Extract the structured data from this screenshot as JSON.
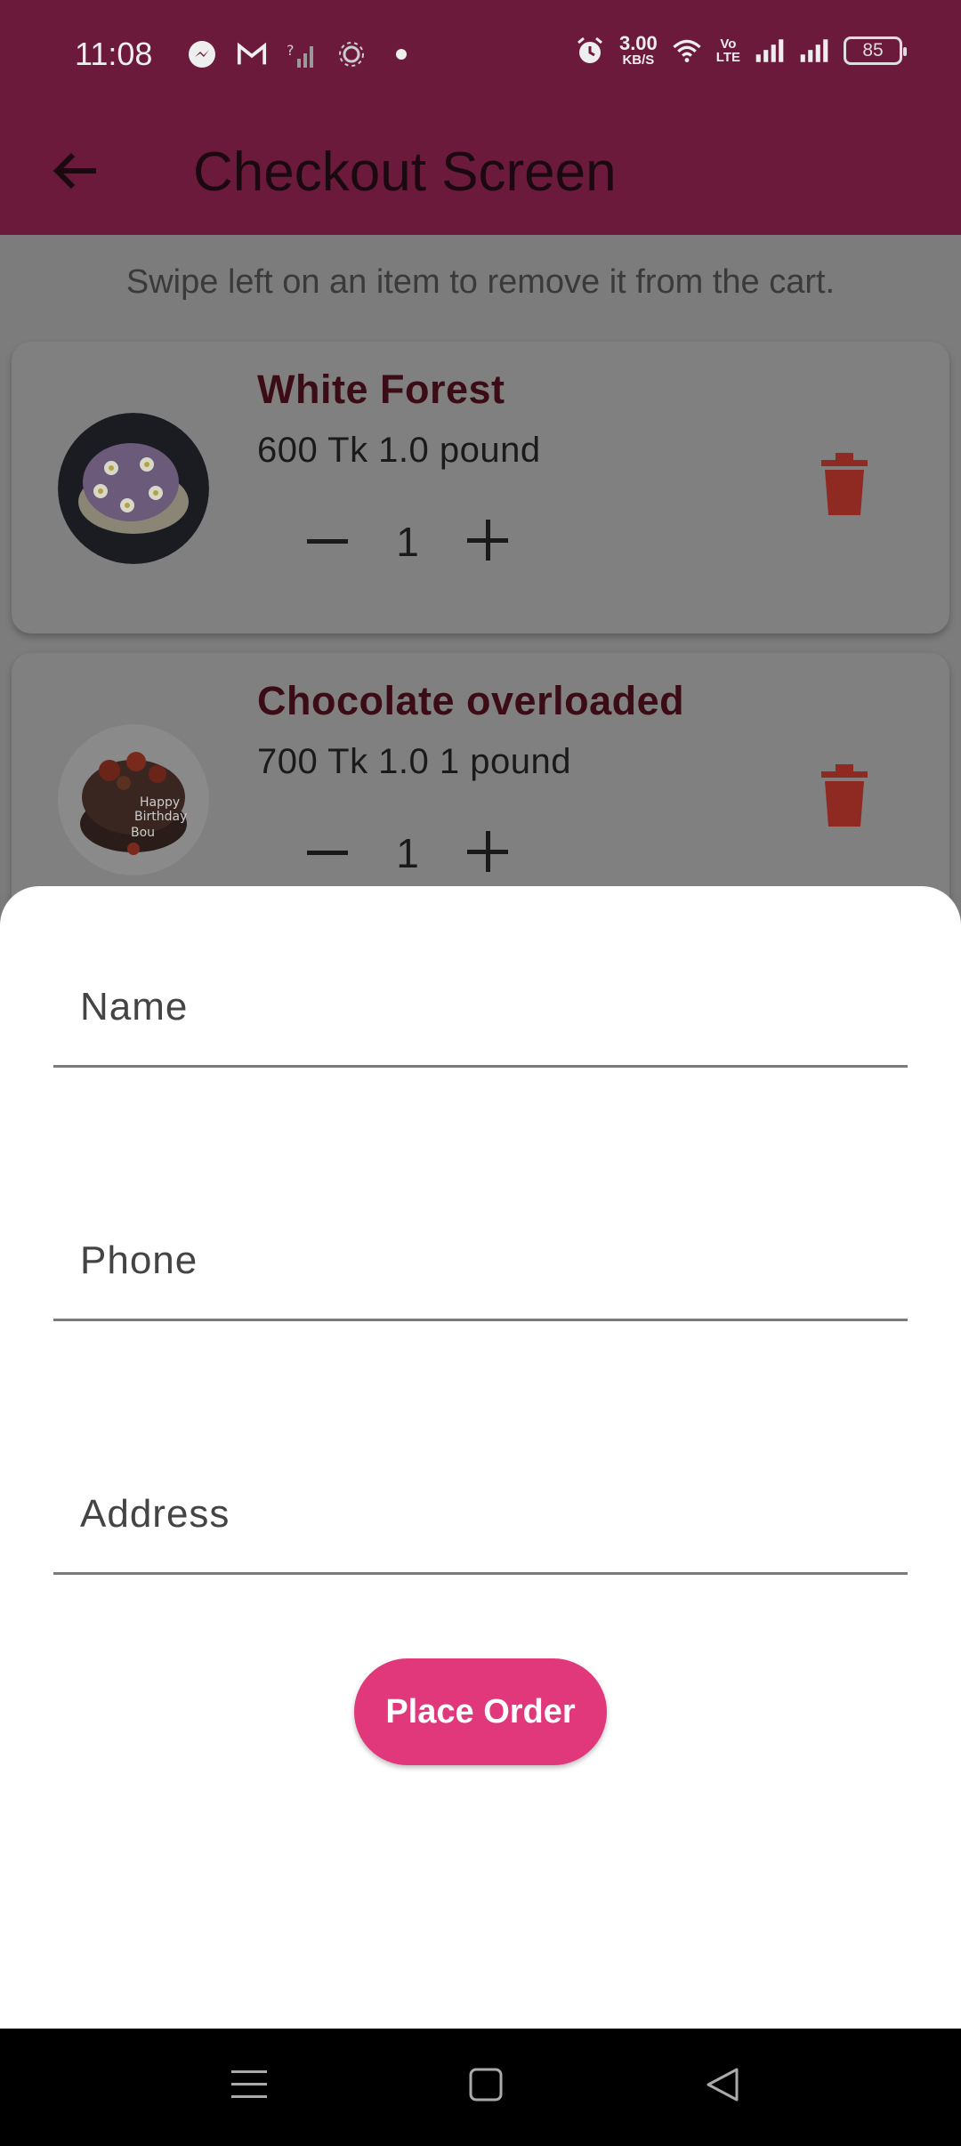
{
  "status_bar": {
    "time": "11:08",
    "net_speed_value": "3.00",
    "net_speed_unit": "KB/S",
    "volte_top": "Vo",
    "volte_bottom": "LTE",
    "battery": "85",
    "left_icons": [
      "messenger-icon",
      "gmail-icon",
      "no-signal-icon",
      "settings-cog-icon",
      "dot-icon"
    ],
    "right_icons": [
      "alarm-icon",
      "wifi-icon",
      "volte-icon",
      "signal-icon",
      "signal-icon",
      "battery-icon"
    ]
  },
  "app_bar": {
    "title": "Checkout Screen",
    "back_icon": "arrow-left-icon",
    "color": "#6b1a3c"
  },
  "hint": "Swipe left on an item to remove it from the cart.",
  "cart": {
    "items": [
      {
        "name": "White Forest",
        "price_line": "600 Tk  1.0 pound",
        "quantity": "1",
        "image": "purple-daisy-cake",
        "minus_icon": "minus-icon",
        "plus_icon": "plus-icon",
        "delete_icon": "trash-icon"
      },
      {
        "name": "Chocolate overloaded",
        "price_line": "700 Tk  1.0 1 pound",
        "quantity": "1",
        "image": "chocolate-birthday-cake",
        "minus_icon": "minus-icon",
        "plus_icon": "plus-icon",
        "delete_icon": "trash-icon"
      }
    ]
  },
  "order_form": {
    "name_placeholder": "Name",
    "phone_placeholder": "Phone",
    "address_placeholder": "Address",
    "name_value": "",
    "phone_value": "",
    "address_value": "",
    "submit_label": "Place Order",
    "accent": "#e1387c"
  },
  "nav_bar": {
    "icons": [
      "menu-icon",
      "home-square-icon",
      "back-triangle-icon"
    ]
  },
  "colors": {
    "delete_red": "#8f2a22",
    "scrim": "#7c7c7c"
  }
}
